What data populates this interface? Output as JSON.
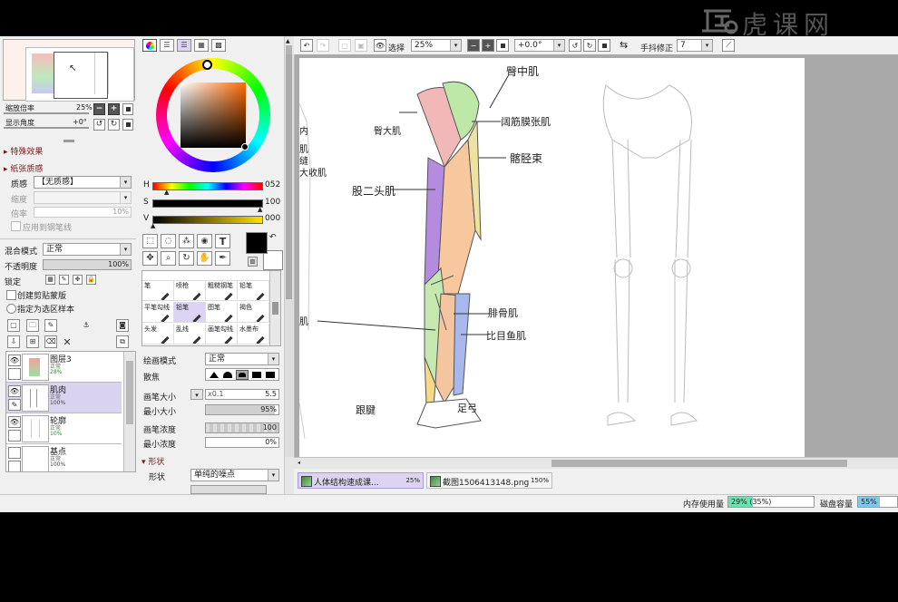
{
  "watermark": {
    "text": "虎课网"
  },
  "navigator": {
    "zoom_label": "缩放倍率",
    "zoom_value": "25%",
    "angle_label": "显示角度",
    "angle_value": "+0°"
  },
  "sections": {
    "special_effects": "特殊效果",
    "paper_texture": "纸张质感"
  },
  "texture": {
    "quality_label": "质感",
    "quality_value": "【无质感】",
    "scale_label": "缩度",
    "scale_value": "",
    "multiplier_label": "倍率",
    "multiplier_value": "10%",
    "apply_brush_label": "应用到钢笔线"
  },
  "layer_props": {
    "blend_label": "混合模式",
    "blend_value": "正常",
    "opacity_label": "不透明度",
    "opacity_value": "100%",
    "lock_label": "锁定",
    "clip_mask_label": "创建剪贴蒙版",
    "sample_label": "指定为选区样本"
  },
  "layers": [
    {
      "name": "图层3",
      "mode": "正常",
      "opacity": "28%"
    },
    {
      "name": "肌肉",
      "mode": "正常",
      "opacity": "100%"
    },
    {
      "name": "轮廓",
      "mode": "正常",
      "opacity": "10%"
    },
    {
      "name": "基点",
      "mode": "正常",
      "opacity": "100%"
    }
  ],
  "color": {
    "h_label": "H",
    "h_value": "052",
    "s_label": "S",
    "s_value": "100",
    "v_label": "V",
    "v_value": "000",
    "foreground": "#000000",
    "background": "#ffffff"
  },
  "tools": [
    "笔",
    "喷枪",
    "粗糙钢笔",
    "铅笔",
    "平笔勾线",
    "铅笔",
    "图笔",
    "褐色",
    "头发",
    "乱线",
    "画笔勾线",
    "水墨布"
  ],
  "brush": {
    "draw_mode_label": "绘画模式",
    "draw_mode_value": "正常",
    "scatter_label": "散焦",
    "size_label": "画笔大小",
    "size_mult": "x0.1",
    "size_value": "5.5",
    "min_size_label": "最小大小",
    "min_size_value": "95%",
    "density_label": "画笔浓度",
    "density_value": "100",
    "min_density_label": "最小浓度",
    "min_density_value": "0%",
    "shape_section": "形状",
    "shape_label": "形状",
    "shape_value": "单纯的噪点"
  },
  "toolbar": {
    "select_label": "选择",
    "zoom_value": "25%",
    "rotate_value": "+0.0°",
    "stabilizer_label": "手抖修正",
    "stabilizer_value": "7"
  },
  "canvas": {
    "annotations": [
      "臀中肌",
      "阔筋膜张肌",
      "髂胫束",
      "臀大肌",
      "股二头肌",
      "腓骨肌",
      "比目鱼肌",
      "腓肠肌",
      "跟腱",
      "足弓"
    ],
    "left_edge_labels": [
      "内",
      "肌",
      "缝",
      "大收肌",
      "肌"
    ]
  },
  "tabs": [
    {
      "name": "人体结构速成课...",
      "zoom": "25%"
    },
    {
      "name": "截图1506413148.png",
      "zoom": "150%"
    }
  ],
  "status": {
    "memory_label": "内存使用量",
    "memory_value": "29%",
    "memory_paren": "(35%)",
    "memory_fraction": 0.29,
    "disk_label": "磁盘容量",
    "disk_value": "55%",
    "disk_fraction": 0.55
  }
}
